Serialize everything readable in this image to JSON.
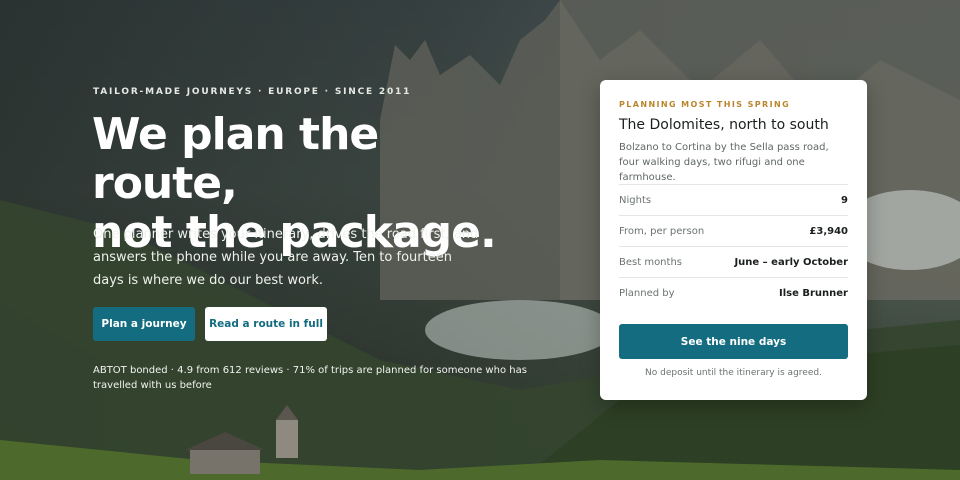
{
  "hero": {
    "eyebrow": "TAILOR-MADE JOURNEYS · EUROPE · SINCE 2011",
    "headline_line1": "We plan the route,",
    "headline_line2": "not the package.",
    "lede": "One planner writes your itinerary, drives the road first, and answers the phone while you are away. Ten to fourteen days is where we do our best work.",
    "primary_button": "Plan a journey",
    "secondary_button": "Read a route in full",
    "proof": "ABTOT bonded · 4.9 from 612 reviews · 71% of trips are planned for someone who has travelled with us before"
  },
  "card": {
    "eyebrow": "PLANNING MOST THIS SPRING",
    "title": "The Dolomites, north to south",
    "description": "Bolzano to Cortina by the Sella pass road, four walking days, two rifugi and one farmhouse.",
    "specs": [
      {
        "label": "Nights",
        "value": "9"
      },
      {
        "label": "From, per person",
        "value": "£3,940"
      },
      {
        "label": "Best months",
        "value": "June – early October"
      },
      {
        "label": "Planned by",
        "value": "Ilse Brunner"
      }
    ],
    "button": "See the nine days",
    "note": "No deposit until the itinerary is agreed."
  },
  "colors": {
    "accent": "#136c80",
    "eyebrow_gold": "#b8862e"
  }
}
